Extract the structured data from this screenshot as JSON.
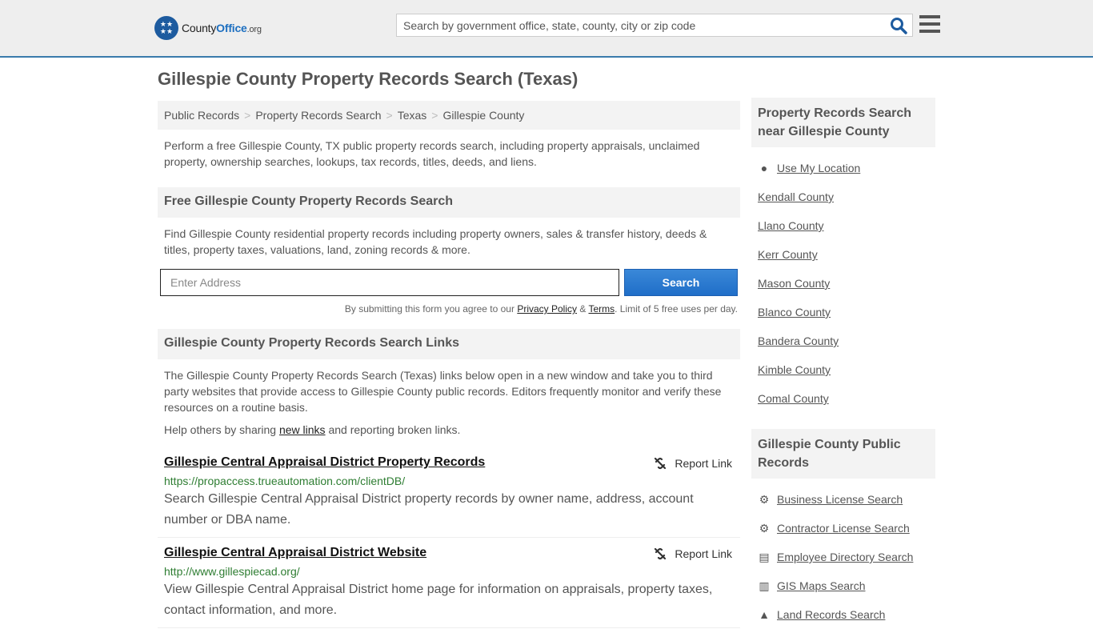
{
  "header": {
    "logo": {
      "brand_left": "County",
      "brand_bold": "Office",
      "brand_suffix": ".org"
    },
    "search_placeholder": "Search by government office, state, county, city or zip code",
    "search_icon": "search-icon",
    "menu_icon": "hamburger-menu-icon"
  },
  "page": {
    "title": "Gillespie County Property Records Search (Texas)",
    "breadcrumbs": [
      "Public Records",
      "Property Records Search",
      "Texas",
      "Gillespie County"
    ],
    "intro": "Perform a free Gillespie County, TX public property records search, including property appraisals, unclaimed property, ownership searches, lookups, tax records, titles, deeds, and liens."
  },
  "free_search": {
    "heading": "Free Gillespie County Property Records Search",
    "description": "Find Gillespie County residential property records including property owners, sales & transfer history, deeds & titles, property taxes, valuations, land, zoning records & more.",
    "address_placeholder": "Enter Address",
    "button_label": "Search",
    "terms_prefix": "By submitting this form you agree to our ",
    "privacy_label": "Privacy Policy",
    "amp": " & ",
    "terms_label": "Terms",
    "terms_suffix": ". Limit of 5 free uses per day."
  },
  "links_section": {
    "heading": "Gillespie County Property Records Search Links",
    "description": "The Gillespie County Property Records Search (Texas) links below open in a new window and take you to third party websites that provide access to Gillespie County public records. Editors frequently monitor and verify these resources on a routine basis.",
    "help_prefix": "Help others by sharing ",
    "help_link": "new links",
    "help_suffix": " and reporting broken links.",
    "report_label": "Report Link",
    "items": [
      {
        "title": "Gillespie Central Appraisal District Property Records",
        "url": "https://propaccess.trueautomation.com/clientDB/",
        "description": "Search Gillespie Central Appraisal District property records by owner name, address, account number or DBA name."
      },
      {
        "title": "Gillespie Central Appraisal District Website",
        "url": "http://www.gillespiecad.org/",
        "description": "View Gillespie Central Appraisal District home page for information on appraisals, property taxes, contact information, and more."
      }
    ]
  },
  "sidebar": {
    "nearby_heading": "Property Records Search near Gillespie County",
    "use_location": "Use My Location",
    "nearby": [
      "Kendall County",
      "Llano County",
      "Kerr County",
      "Mason County",
      "Blanco County",
      "Bandera County",
      "Kimble County",
      "Comal County"
    ],
    "public_heading": "Gillespie County Public Records",
    "public_records": [
      {
        "label": "Business License Search",
        "icon": "gears-icon"
      },
      {
        "label": "Contractor License Search",
        "icon": "gear-icon"
      },
      {
        "label": "Employee Directory Search",
        "icon": "book-icon"
      },
      {
        "label": "GIS Maps Search",
        "icon": "map-icon"
      },
      {
        "label": "Land Records Search",
        "icon": "land-icon"
      }
    ]
  }
}
